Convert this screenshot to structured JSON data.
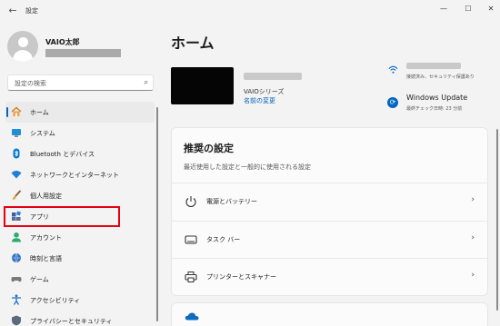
{
  "window": {
    "back_glyph": "←",
    "title": "設定",
    "minimize_glyph": "—",
    "maximize_glyph": "☐",
    "close_glyph": "✕"
  },
  "user": {
    "name": "VAIO太郎"
  },
  "search": {
    "placeholder": "設定の検索",
    "icon": "search-icon",
    "glyph": "⌕"
  },
  "sidebar": {
    "items": [
      {
        "label": "ホーム",
        "icon": "home-icon",
        "active": true
      },
      {
        "label": "システム",
        "icon": "system-icon"
      },
      {
        "label": "Bluetooth とデバイス",
        "icon": "bluetooth-icon"
      },
      {
        "label": "ネットワークとインターネット",
        "icon": "network-icon"
      },
      {
        "label": "個人用設定",
        "icon": "brush-icon"
      },
      {
        "label": "アプリ",
        "icon": "apps-icon",
        "highlighted": true
      },
      {
        "label": "アカウント",
        "icon": "account-icon"
      },
      {
        "label": "時刻と言語",
        "icon": "time-language-icon"
      },
      {
        "label": "ゲーム",
        "icon": "gaming-icon"
      },
      {
        "label": "アクセシビリティ",
        "icon": "accessibility-icon"
      },
      {
        "label": "プライバシーとセキュリティ",
        "icon": "privacy-icon"
      }
    ]
  },
  "main": {
    "title": "ホーム",
    "device": {
      "series": "VAIOシリーズ",
      "rename_link": "名前の変更"
    },
    "network": {
      "status": "接続済み、セキュリティ保護あり"
    },
    "windows_update": {
      "title": "Windows Update",
      "last_checked": "最終チェック日時: 23 分前",
      "glyph": "⟳"
    },
    "recommended": {
      "title": "推奨の設定",
      "description": "最近使用した設定と一般的に使用される設定",
      "items": [
        {
          "label": "電源とバッテリー",
          "icon": "power-icon"
        },
        {
          "label": "タスク バー",
          "icon": "taskbar-icon"
        },
        {
          "label": "プリンターとスキャナー",
          "icon": "printer-icon"
        }
      ],
      "chevron": "›"
    },
    "cloud": {
      "icon": "onedrive-icon"
    }
  },
  "colors": {
    "accent": "#0067c0",
    "highlight_border": "#e60012",
    "link": "#005fb8"
  }
}
